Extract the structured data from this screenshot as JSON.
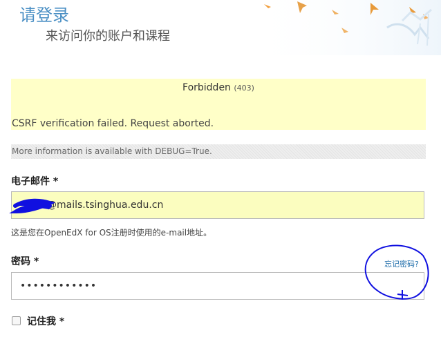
{
  "header": {
    "title": "请登录",
    "subtitle": "来访问你的账户和课程"
  },
  "error": {
    "title": "Forbidden",
    "code": "(403)",
    "message": "CSRF verification failed. Request aborted."
  },
  "info": {
    "text": "More information is available with DEBUG=True."
  },
  "form": {
    "email_label": "电子邮件 *",
    "email_value": "@mails.tsinghua.edu.cn",
    "email_hint": "这是您在OpenEdX for OS注册时使用的e-mail地址。",
    "password_label": "密码 *",
    "password_value": "••••••••••••",
    "forgot_label": "忘记密码?",
    "remember_label": "记住我 *"
  },
  "colors": {
    "title": "#4a8fc4",
    "error_bg": "#ffffc8",
    "email_bg": "#fbfdbf",
    "annotation": "#1010e0"
  },
  "icons": [
    "bird-decoration",
    "checkbox"
  ]
}
